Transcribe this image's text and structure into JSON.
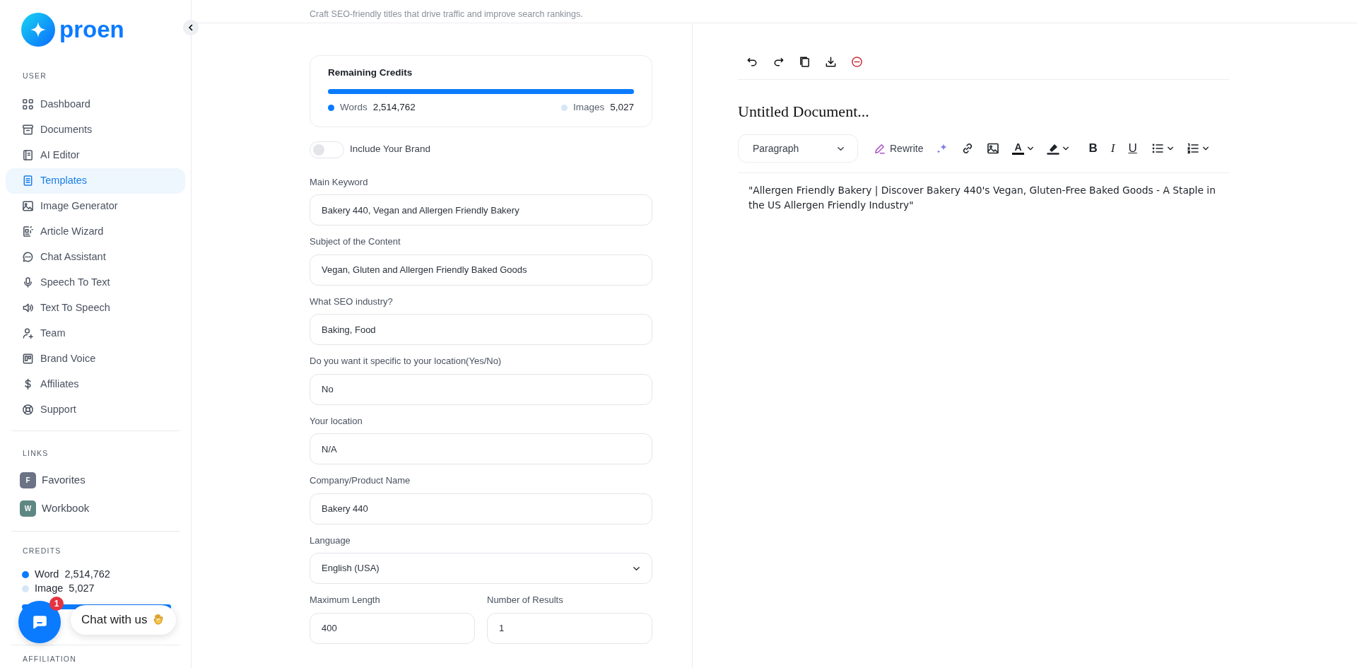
{
  "header": {
    "subtitle": "Craft SEO-friendly titles that drive traffic and improve search rankings."
  },
  "sidebar": {
    "logo": "proen",
    "user_section": {
      "title": "USER",
      "items": [
        {
          "label": "Dashboard",
          "selected": false
        },
        {
          "label": "Documents",
          "selected": false
        },
        {
          "label": "AI Editor",
          "selected": false
        },
        {
          "label": "Templates",
          "selected": true
        },
        {
          "label": "Image Generator",
          "selected": false
        },
        {
          "label": "Article Wizard",
          "selected": false
        },
        {
          "label": "Chat Assistant",
          "selected": false
        },
        {
          "label": "Speech To Text",
          "selected": false
        },
        {
          "label": "Text To Speech",
          "selected": false
        },
        {
          "label": "Team",
          "selected": false
        },
        {
          "label": "Brand Voice",
          "selected": false
        },
        {
          "label": "Affiliates",
          "selected": false
        },
        {
          "label": "Support",
          "selected": false
        }
      ]
    },
    "links_section": {
      "title": "LINKS",
      "items": [
        {
          "initial": "F",
          "label": "Favorites",
          "color": "#6b7385"
        },
        {
          "initial": "W",
          "label": "Workbook",
          "color": "#5e8784"
        }
      ]
    },
    "credits_section": {
      "title": "CREDITS",
      "level": 1,
      "items": [
        {
          "label": "Word",
          "value": "2,514,762",
          "color": "#0a7bff"
        },
        {
          "label": "Image",
          "value": "5,027",
          "color": "#d6e6f7"
        }
      ]
    },
    "affiliation_title": "AFFILIATION"
  },
  "credits_card": {
    "title": "Remaining Credits",
    "level": 1,
    "items": [
      {
        "label": "Words",
        "value": "2,514,762",
        "color": "#0a7bff"
      },
      {
        "label": "Images",
        "value": "5,027",
        "color": "#d6e6f7"
      }
    ]
  },
  "brand_toggle": {
    "label": "Include Your Brand",
    "on": false
  },
  "fields": [
    {
      "label": "Main Keyword",
      "value": "Bakery 440, Vegan and Allergen Friendly Bakery",
      "kind": "text"
    },
    {
      "label": "Subject of the Content",
      "value": "Vegan, Gluten and Allergen Friendly Baked Goods",
      "kind": "text"
    },
    {
      "label": "What SEO industry?",
      "value": "Baking, Food",
      "kind": "text"
    },
    {
      "label": "Do you want it specific to your location(Yes/No)",
      "value": "No",
      "kind": "text"
    },
    {
      "label": "Your location",
      "value": "N/A",
      "kind": "text"
    },
    {
      "label": "Company/Product Name",
      "value": "Bakery 440",
      "kind": "text"
    },
    {
      "label": "Language",
      "value": "English (USA)",
      "kind": "select"
    }
  ],
  "field_pair": [
    {
      "label": "Maximum Length",
      "value": "400"
    },
    {
      "label": "Number of Results",
      "value": "1"
    }
  ],
  "editor": {
    "title": "Untitled Document...",
    "block_format": "Paragraph",
    "rewrite": "Rewrite",
    "text_color": "A",
    "format_buttons": [
      {
        "label": "B",
        "kind": "bold"
      },
      {
        "label": "I",
        "kind": "italic"
      },
      {
        "label": "U",
        "kind": "underline"
      }
    ],
    "body": "\"Allergen Friendly Bakery | Discover Bakery 440's Vegan, Gluten-Free Baked Goods - A Staple in the US Allergen Friendly Industry\""
  },
  "chat": {
    "label": "Chat with us",
    "badge": "1"
  }
}
